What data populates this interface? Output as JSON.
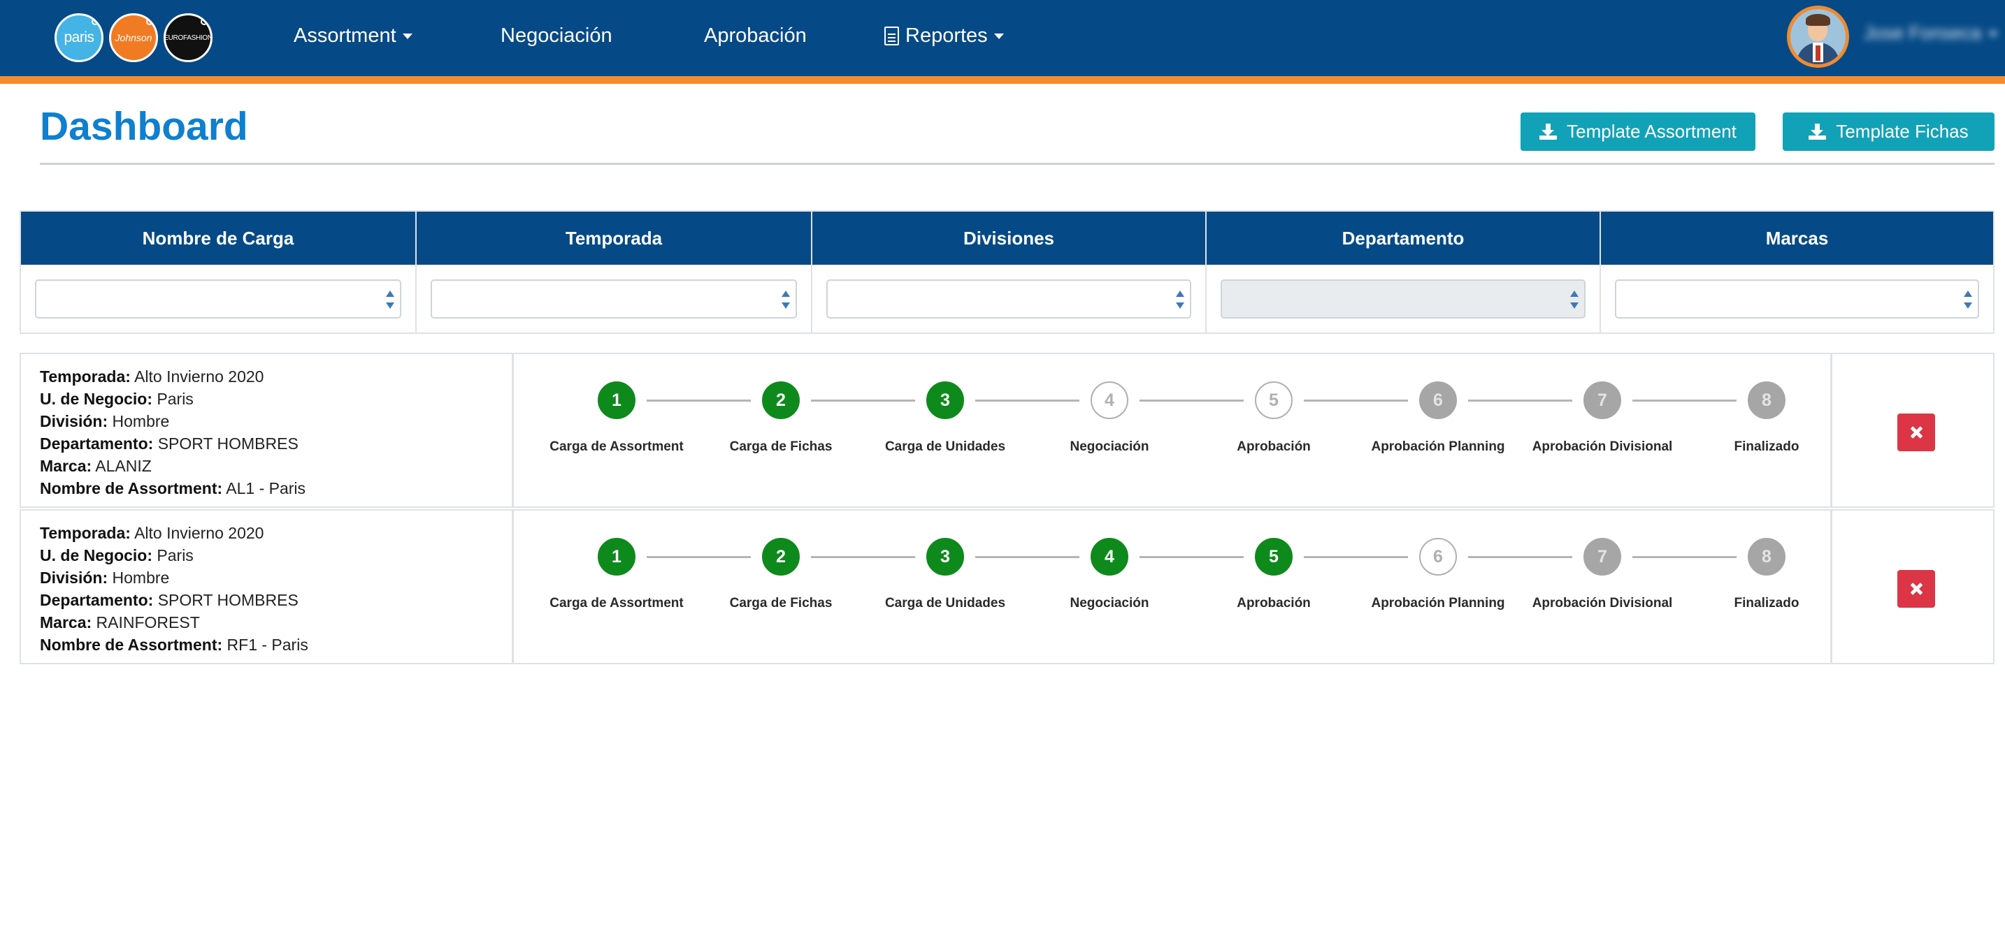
{
  "nav": {
    "brand_logos": [
      {
        "name": "paris",
        "text": "paris",
        "color": "#44b3e6"
      },
      {
        "name": "johnson",
        "text": "Johnson",
        "color": "#f17b23"
      },
      {
        "name": "europe-fashion",
        "text": "EUROFASHION",
        "color": "#111111"
      }
    ],
    "items": [
      {
        "label": "Assortment",
        "dropdown": true
      },
      {
        "label": "Negociación",
        "dropdown": false
      },
      {
        "label": "Aprobación",
        "dropdown": false
      },
      {
        "label": "Reportes",
        "dropdown": true,
        "icon": "document-icon"
      }
    ],
    "user_name": "Jose Fonseca",
    "colors": {
      "bar": "#054a86",
      "accent": "#f58b2b"
    }
  },
  "page": {
    "title": "Dashboard",
    "buttons": {
      "template_assortment": "Template Assortment",
      "template_fichas": "Template Fichas"
    }
  },
  "filters": {
    "columns": [
      {
        "header": "Nombre de Carga",
        "value": "",
        "disabled": false
      },
      {
        "header": "Temporada",
        "value": "",
        "disabled": false
      },
      {
        "header": "Divisiones",
        "value": "",
        "disabled": false
      },
      {
        "header": "Departamento",
        "value": "",
        "disabled": true
      },
      {
        "header": "Marcas",
        "value": "",
        "disabled": false
      }
    ]
  },
  "info_labels": {
    "temporada": "Temporada:",
    "negocio": "U. de Negocio:",
    "division": "División:",
    "departamento": "Departamento:",
    "marca": "Marca:",
    "assortment": "Nombre de Assortment:"
  },
  "step_labels": [
    "Carga de Assortment",
    "Carga de Fichas",
    "Carga de Unidades",
    "Negociación",
    "Aprobación",
    "Aprobación Planning",
    "Aprobación Divisional",
    "Finalizado"
  ],
  "step_colors": {
    "done": "#0e8a1c",
    "pending": "#b0b0b0",
    "locked": "#a6a6a6"
  },
  "rows": [
    {
      "temporada": "Alto Invierno 2020",
      "negocio": "Paris",
      "division": "Hombre",
      "departamento": "SPORT HOMBRES",
      "marca": "ALANIZ",
      "assortment": "AL1 - Paris",
      "steps": [
        {
          "n": "1",
          "state": "done"
        },
        {
          "n": "2",
          "state": "done"
        },
        {
          "n": "3",
          "state": "done"
        },
        {
          "n": "4",
          "state": "pending"
        },
        {
          "n": "5",
          "state": "pending"
        },
        {
          "n": "6",
          "state": "locked"
        },
        {
          "n": "7",
          "state": "locked"
        },
        {
          "n": "8",
          "state": "locked"
        }
      ]
    },
    {
      "temporada": "Alto Invierno 2020",
      "negocio": "Paris",
      "division": "Hombre",
      "departamento": "SPORT HOMBRES",
      "marca": "RAINFOREST",
      "assortment": "RF1 - Paris",
      "steps": [
        {
          "n": "1",
          "state": "done"
        },
        {
          "n": "2",
          "state": "done"
        },
        {
          "n": "3",
          "state": "done"
        },
        {
          "n": "4",
          "state": "done"
        },
        {
          "n": "5",
          "state": "done"
        },
        {
          "n": "6",
          "state": "pending"
        },
        {
          "n": "7",
          "state": "locked"
        },
        {
          "n": "8",
          "state": "locked"
        }
      ]
    }
  ]
}
